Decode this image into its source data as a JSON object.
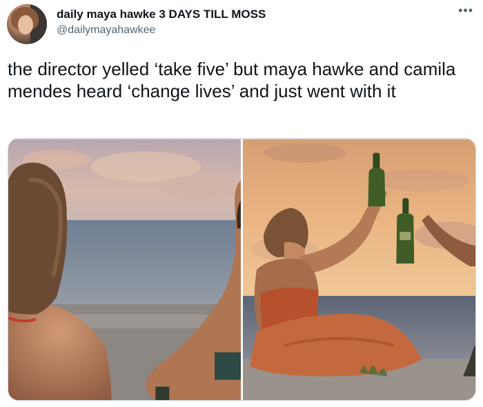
{
  "tweet": {
    "display_name": "daily maya hawke 3 DAYS TILL MOSS",
    "handle": "@dailymayahawkee",
    "more_icon": "more-horizontal-icon",
    "text": "the director yelled ‘take five’ but maya hawke and camila mendes heard ‘change lives’ and just went with it"
  },
  "colors": {
    "name": "#0f1419",
    "handle": "#536471",
    "border": "#cfd9de"
  }
}
